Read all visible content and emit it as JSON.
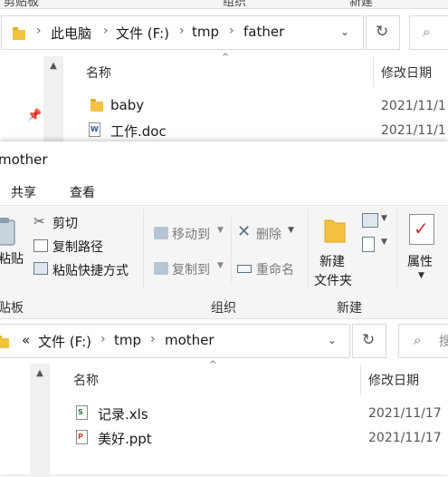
{
  "back_window": {
    "ribbon_labels": [
      "剪贴板",
      "组织",
      "新建"
    ],
    "address": {
      "segments": [
        "此电脑",
        "文件 (F:)",
        "tmp",
        "father"
      ]
    },
    "columns": {
      "name": "名称",
      "date": "修改日期"
    },
    "files": [
      {
        "name": "baby",
        "type": "folder",
        "date": "2021/11/1"
      },
      {
        "name": "工作.doc",
        "type": "word",
        "date": "2021/11/1"
      }
    ]
  },
  "front_window": {
    "title": "mother",
    "tabs": [
      "共享",
      "查看"
    ],
    "ribbon": {
      "paste_label": "粘贴",
      "cut_label": "剪切",
      "copy_path_label": "复制路径",
      "paste_shortcut_label": "粘贴快捷方式",
      "move_to_label": "移动到",
      "copy_to_label": "复制到",
      "delete_label": "删除",
      "rename_label": "重命名",
      "new_folder_label_1": "新建",
      "new_folder_label_2": "文件夹",
      "properties_label": "属性",
      "group_clipboard": "贴板",
      "group_organize": "组织",
      "group_new": "新建"
    },
    "address": {
      "prefix": "«",
      "segments": [
        "文件 (F:)",
        "tmp",
        "mother"
      ],
      "search_partial": "搜"
    },
    "columns": {
      "name": "名称",
      "date": "修改日期"
    },
    "files": [
      {
        "name": "记录.xls",
        "type": "excel",
        "date": "2021/11/17"
      },
      {
        "name": "美好.ppt",
        "type": "ppt",
        "date": "2021/11/17"
      }
    ]
  },
  "colors": {
    "folder": "#f3c243",
    "accent": "#1e6fd9",
    "ribbon_bg": "#f5f5f5"
  }
}
